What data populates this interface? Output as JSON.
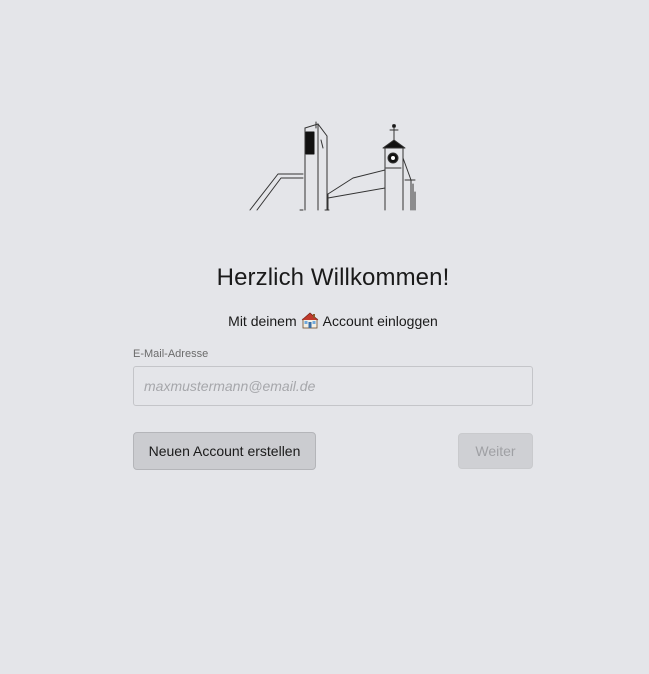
{
  "header": {
    "logo_icon": "church-sketch-icon",
    "title": "Herzlich Willkommen!"
  },
  "subtitle": {
    "prefix": "Mit deinem",
    "icon": "house-icon",
    "suffix": "Account einloggen"
  },
  "login_form": {
    "email_label": "E-Mail-Adresse",
    "email_value": "",
    "email_placeholder": "maxmustermann@email.de"
  },
  "actions": {
    "create_account_label": "Neuen Account erstellen",
    "next_label": "Weiter",
    "next_disabled": true
  }
}
